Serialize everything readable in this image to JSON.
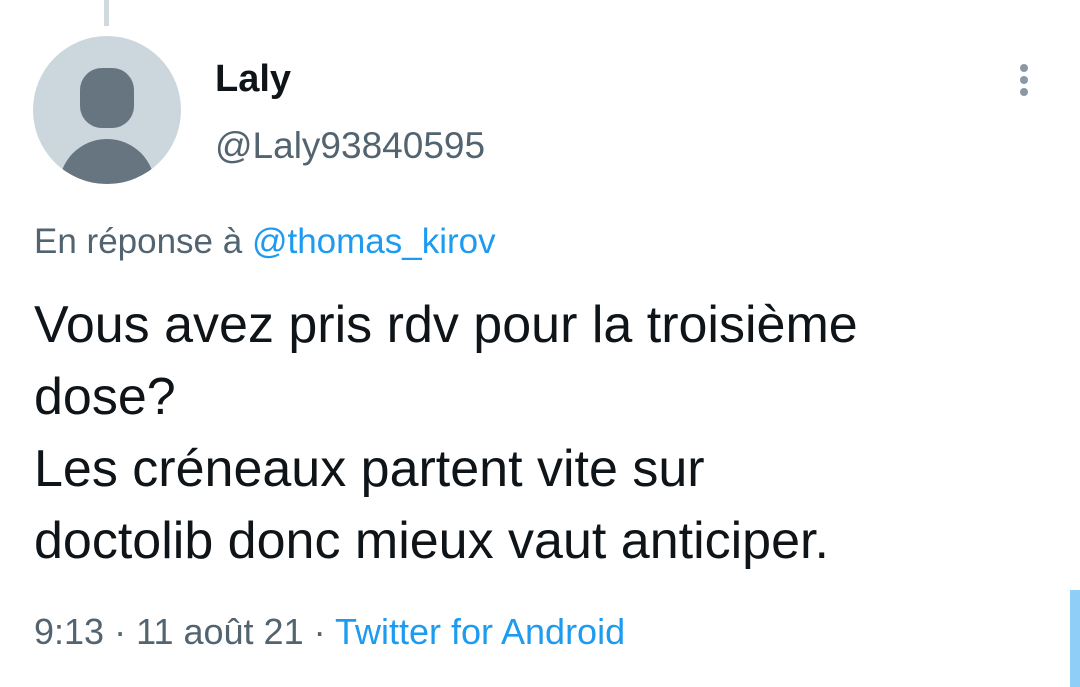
{
  "tweet": {
    "author": {
      "display_name": "Laly",
      "handle": "@Laly93840595"
    },
    "reply_context": {
      "prefix": "En réponse à",
      "mention": "@thomas_kirov"
    },
    "text_lines": [
      "Vous avez pris rdv pour la troisième",
      "dose?",
      "Les créneaux partent vite sur",
      "doctolib donc mieux vaut anticiper."
    ],
    "time": "9:13",
    "separator": "·",
    "date": "11 août 21",
    "source": "Twitter for Android"
  },
  "icons": {
    "more": "more-vertical-icon",
    "avatar": "default-profile-icon"
  },
  "colors": {
    "link": "#1d9bf0",
    "secondary_text": "#536471",
    "primary_text": "#0f1419",
    "avatar_bg": "#ccd6dd",
    "avatar_figure": "#66757f"
  }
}
